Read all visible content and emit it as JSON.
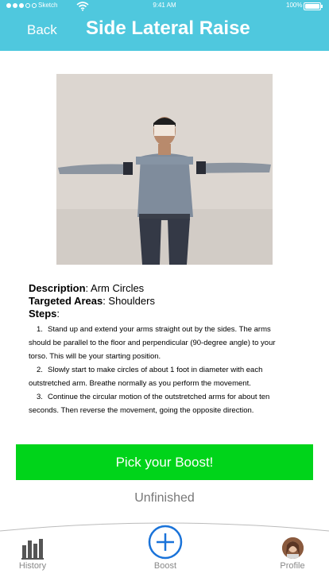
{
  "status_bar": {
    "carrier": "Sketch",
    "time": "9:41 AM",
    "battery": "100%"
  },
  "header": {
    "back_label": "Back",
    "title": "Side Lateral Raise"
  },
  "exercise": {
    "description_label": "Description",
    "description_value": ": Arm Circles",
    "targeted_label": "Targeted Areas",
    "targeted_value": ": Shoulders",
    "steps_label": "Steps",
    "steps_suffix": ":",
    "steps": [
      {
        "num": "1.",
        "text": "Stand up and extend your arms straight out by the sides. The arms"
      },
      {
        "num": "",
        "text": "should be parallel to the floor and perpendicular (90-degree angle) to your"
      },
      {
        "num": "",
        "text": "torso. This will be your starting position."
      },
      {
        "num": "2.",
        "text": "Slowly start to make circles of about 1 foot in diameter with each"
      },
      {
        "num": "",
        "text": "outstretched arm. Breathe normally as you perform the movement."
      },
      {
        "num": "3.",
        "text": "Continue the circular motion of the outstretched arms for about ten"
      },
      {
        "num": "",
        "text": "seconds. Then reverse the movement, going the opposite direction."
      }
    ]
  },
  "actions": {
    "boost_button": "Pick your Boost!",
    "status_text": "Unfinished"
  },
  "tabbar": {
    "history": "History",
    "boost": "Boost",
    "profile": "Profile"
  },
  "colors": {
    "header_bg": "#4fc8de",
    "boost_button_bg": "#00d41a",
    "tab_accent": "#1a73d9"
  }
}
